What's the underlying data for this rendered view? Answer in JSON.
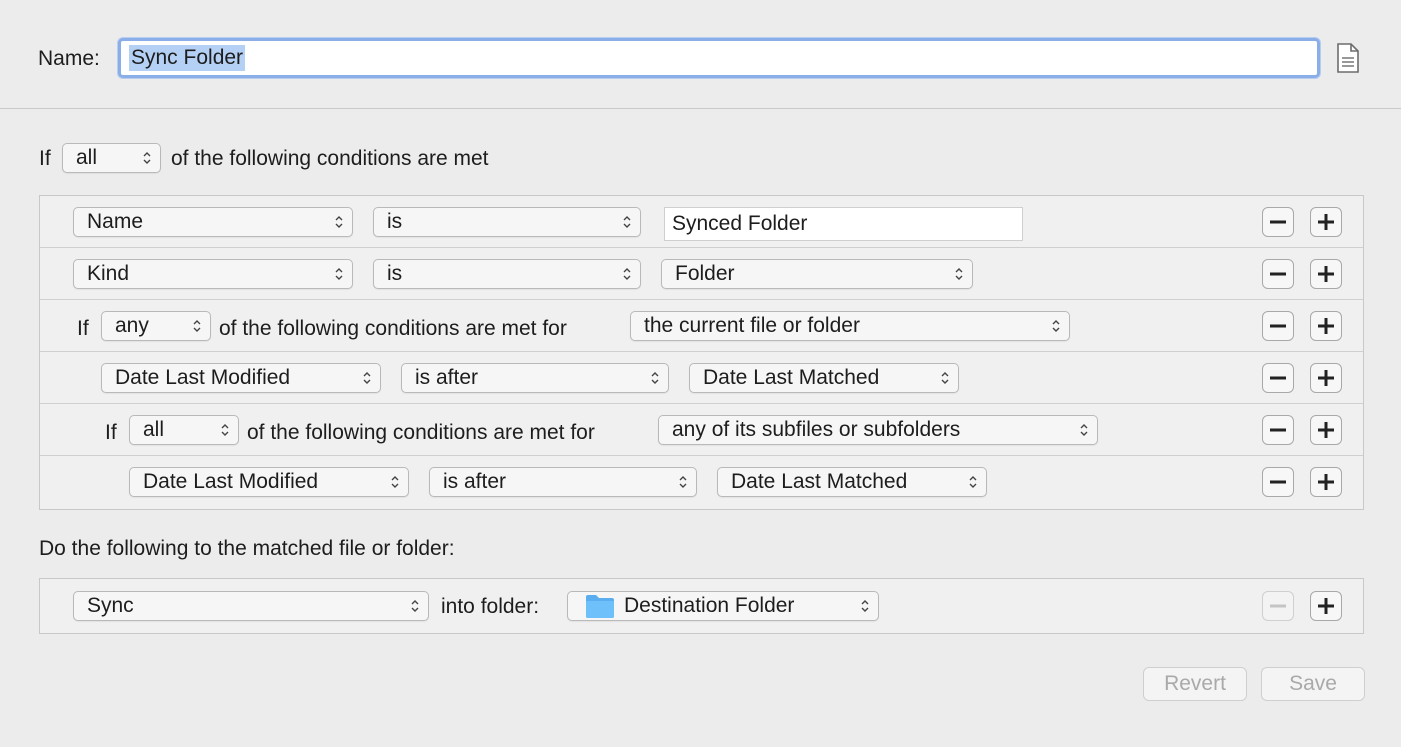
{
  "name_row": {
    "label": "Name:",
    "value": "Sync Folder",
    "icon": "document-icon"
  },
  "conditions_header": {
    "prefix": "If",
    "match": "all",
    "suffix": "of the following conditions are met"
  },
  "rules": [
    {
      "field": "Name",
      "operator": "is",
      "value": "Synced Folder"
    },
    {
      "field": "Kind",
      "operator": "is",
      "value": "Folder"
    },
    {
      "prefix": "If",
      "match": "any",
      "suffix": "of the following conditions are met for",
      "target": "the current file or folder"
    },
    {
      "field": "Date Last Modified",
      "operator": "is after",
      "value": "Date Last Matched"
    },
    {
      "prefix": "If",
      "match": "all",
      "suffix": "of the following conditions are met for",
      "target": "any of its subfiles or subfolders"
    },
    {
      "field": "Date Last Modified",
      "operator": "is after",
      "value": "Date Last Matched"
    }
  ],
  "actions_header": "Do the following to the matched file or folder:",
  "action": {
    "type": "Sync",
    "label": "into folder:",
    "folder": "Destination Folder",
    "folder_icon": "folder-icon"
  },
  "buttons": {
    "revert": "Revert",
    "save": "Save"
  },
  "colors": {
    "selection": "#b4d1f5",
    "focus_ring": "#8aaee8",
    "folder_blue": "#5aaef0"
  }
}
